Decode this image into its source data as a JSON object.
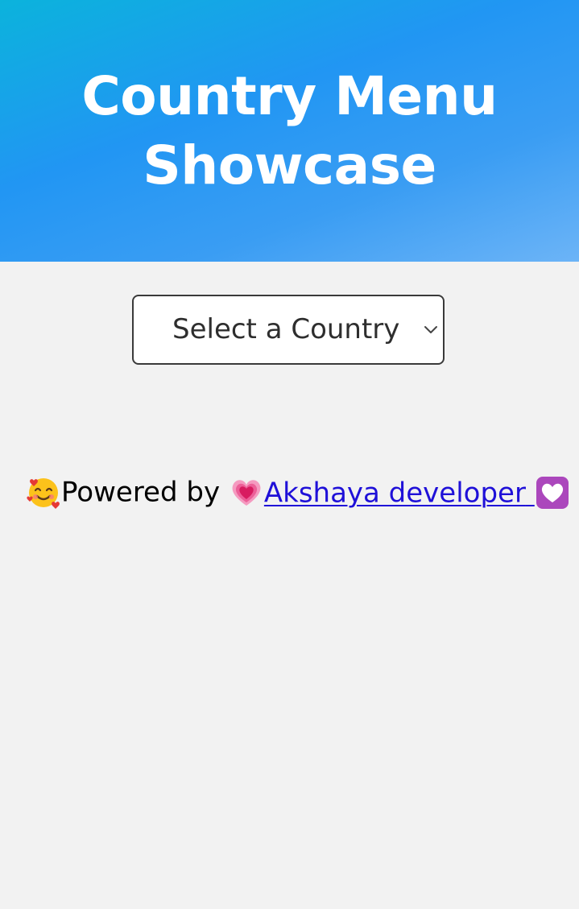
{
  "header": {
    "title_line1": "Country Menu",
    "title_line2": "Showcase",
    "gradient": [
      "#0bb3dc",
      "#2196f3",
      "#6cb4f7"
    ]
  },
  "country_select": {
    "selected": "Select a Country"
  },
  "footer": {
    "prefix_emoji": "smiling-face-with-hearts-icon",
    "prefix_text": "Powered by",
    "link_leading_emoji": "growing-heart-icon",
    "link_text": "Akshaya developer",
    "link_trailing_emoji": "heart-decoration-icon",
    "link_color": "#1f10d8"
  }
}
